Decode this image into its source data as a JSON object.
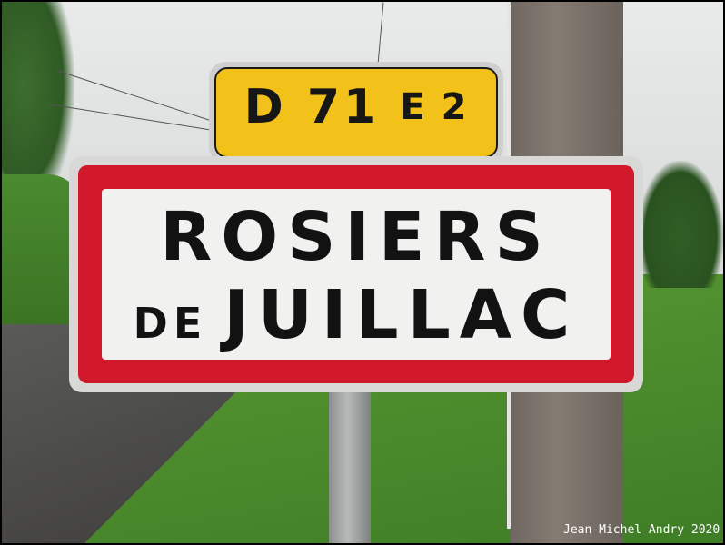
{
  "route_sign": {
    "main": "D 71",
    "suffix": "E 2",
    "color": "#f2c21b"
  },
  "town_sign": {
    "line1": "ROSIERS",
    "line2_prefix": "DE",
    "line2_main": "JUILLAC",
    "border_color": "#d2192b",
    "background_color": "#f1f1ef"
  },
  "credit": "Jean-Michel Andry 2020"
}
